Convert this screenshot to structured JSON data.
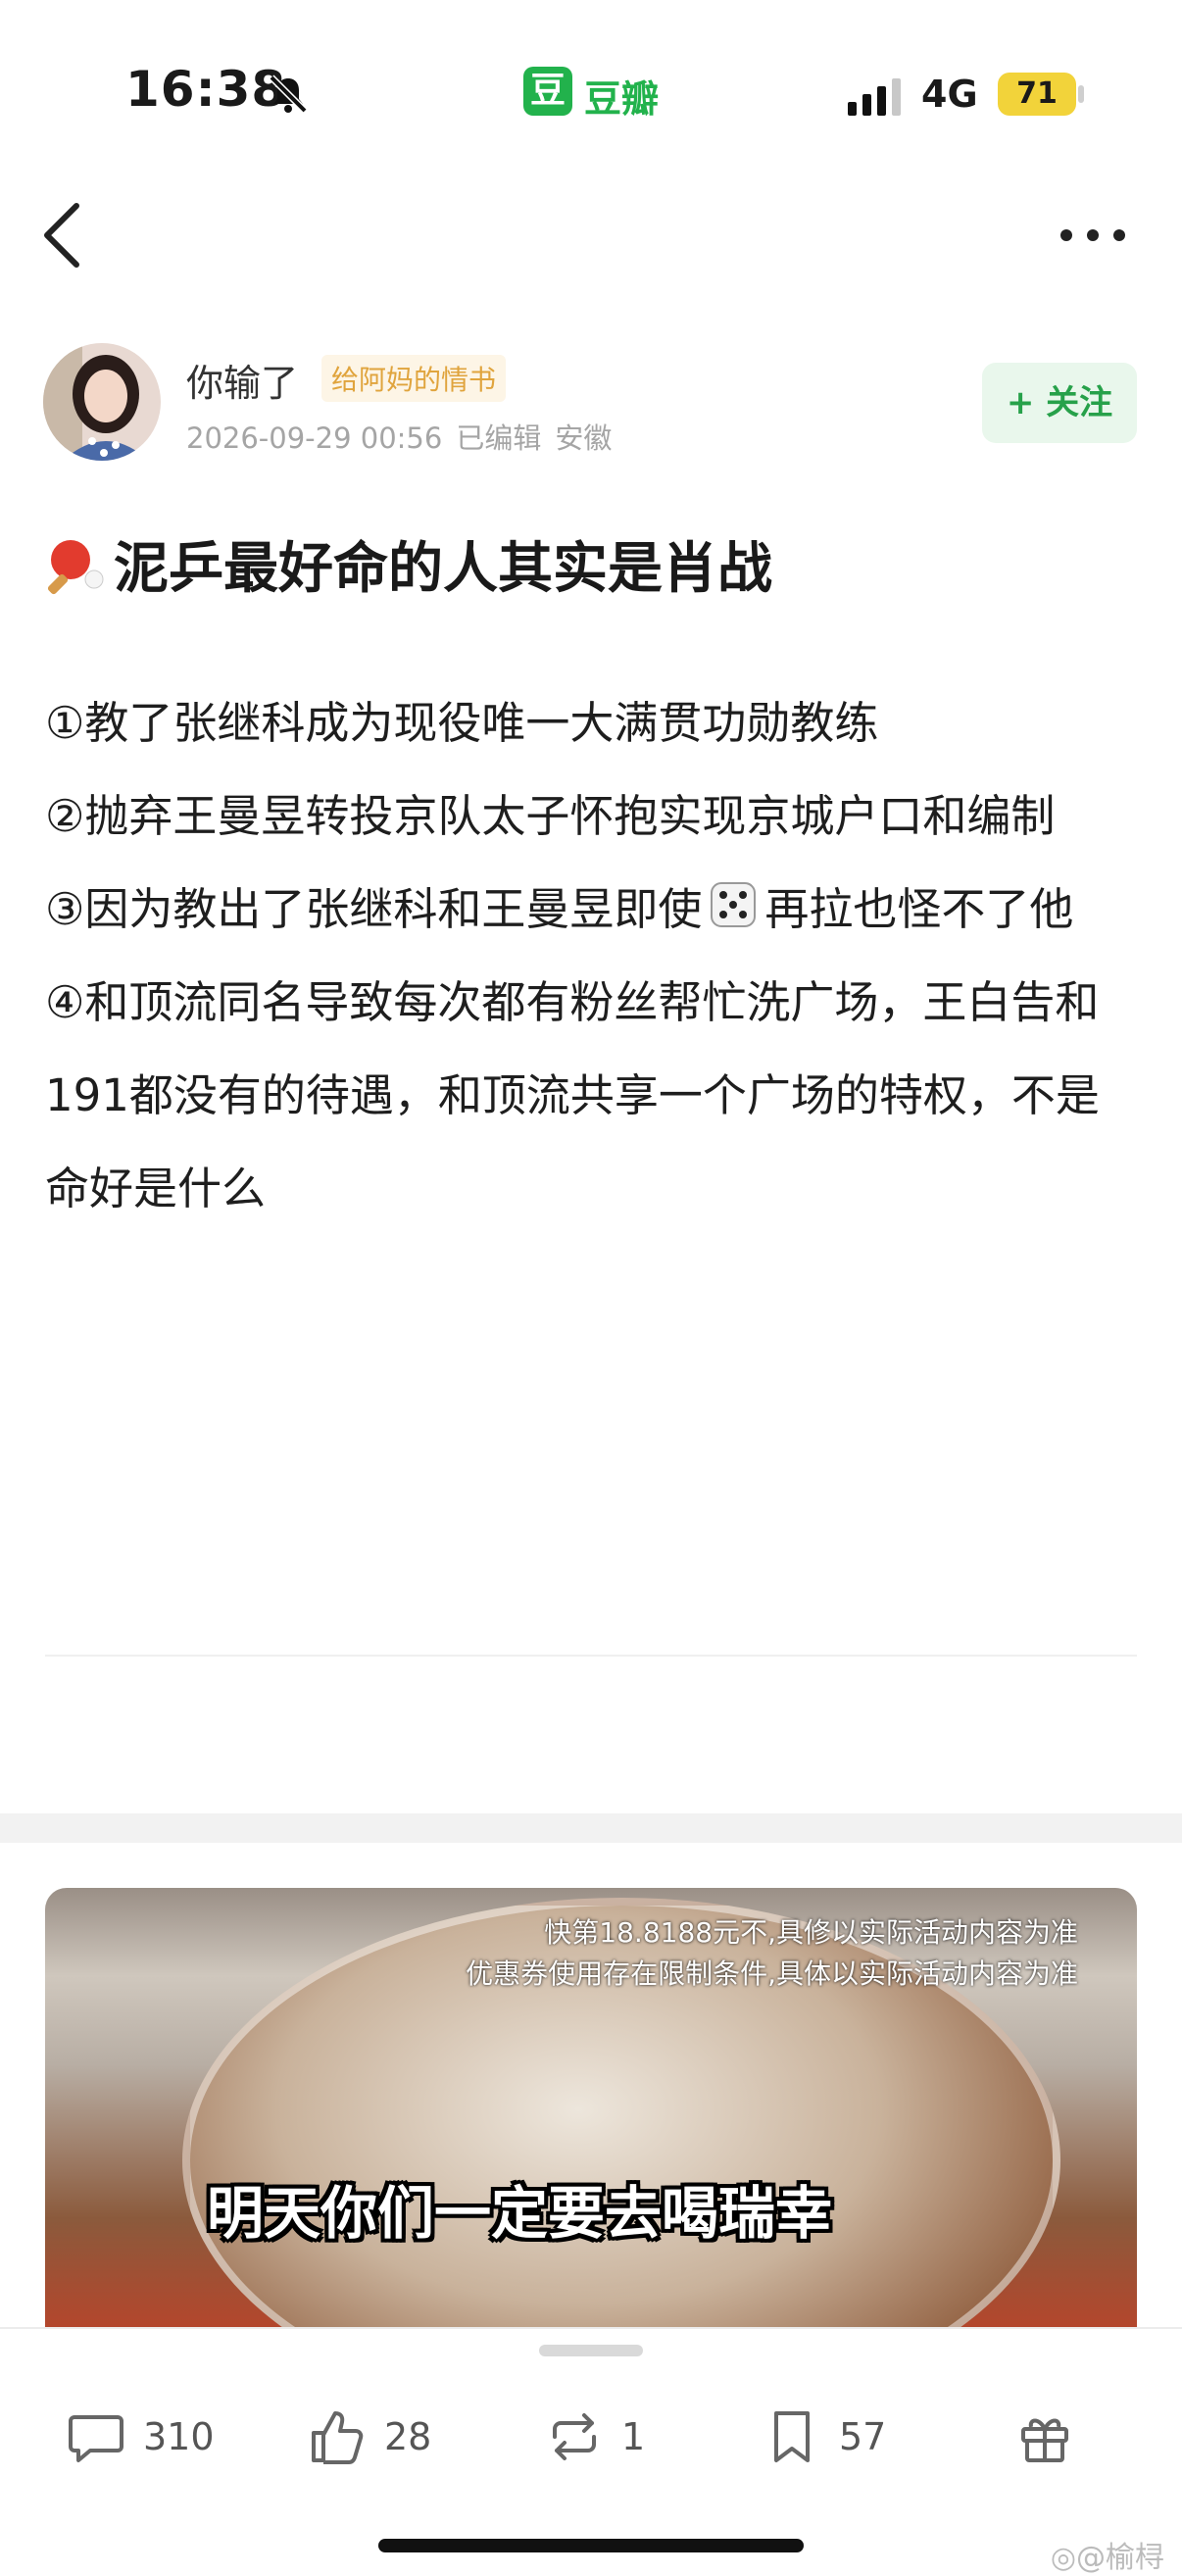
{
  "status_bar": {
    "time": "16:38",
    "network": "4G",
    "battery": "71"
  },
  "app": {
    "badge": "豆",
    "name": "豆瓣"
  },
  "author": {
    "name": "你输了",
    "tag": "给阿妈的情书",
    "datetime": "2026-09-29 00:56",
    "edited": "已编辑",
    "location": "安徽",
    "follow_label": "+ 关注"
  },
  "post": {
    "title": "泥乒最好命的人其实是肖战",
    "p1": "①教了张继科成为现役唯一大满贯功勋教练",
    "p2": "②抛弃王曼昱转投京队太子怀抱实现京城户口和编制",
    "p3_before": "③因为教出了张继科和王曼昱即使",
    "p3_after": "再拉也怪不了他",
    "p4": "④和顶流同名导致每次都有粉丝帮忙洗广场，王白告和191都没有的待遇，和顶流共享一个广场的特权，不是命好是什么"
  },
  "ad": {
    "fine_print_1": "快第18.8188元不,具修以实际活动内容为准",
    "fine_print_2": "优惠券使用存在限制条件,具体以实际活动内容为准",
    "caption": "明天你们一定要去喝瑞幸"
  },
  "actions": {
    "comments": "310",
    "likes": "28",
    "reshares": "1",
    "collects": "57"
  },
  "watermark": "@榆桪",
  "icons": [
    "bell-slash-icon",
    "signal-icon",
    "back-icon",
    "more-icon",
    "ping-pong-icon",
    "dice-icon",
    "comment-icon",
    "like-icon",
    "reshare-icon",
    "bookmark-icon",
    "gift-icon",
    "weibo-icon"
  ]
}
